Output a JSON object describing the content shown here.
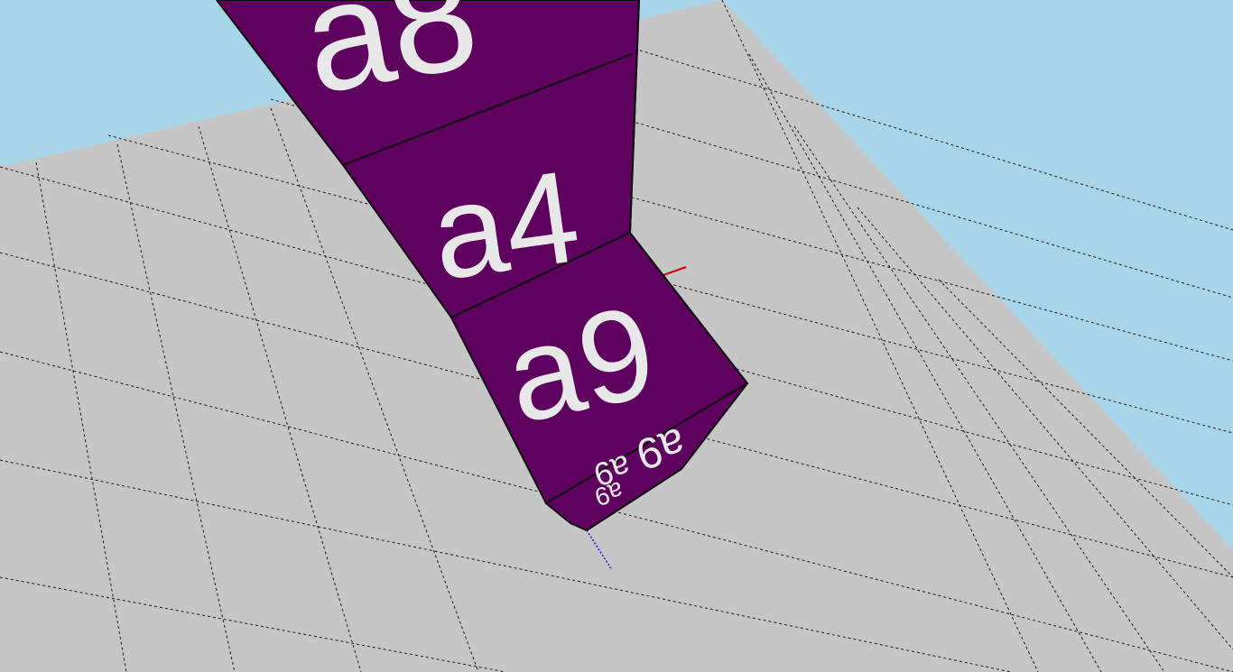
{
  "scene": {
    "sky_color": "#a8d6e8",
    "ground_color": "#c6c6c6",
    "grid_line_color": "#1a1a1a",
    "cube_color": "#5e005e",
    "cube_edge_color": "#101010",
    "label_color": "#e8e8e8"
  },
  "cubes": {
    "top_face_label": "a8",
    "front_upper_label": "a4",
    "front_lower_label": "a9",
    "bottom_label_1": "a9",
    "bottom_label_2": "a9",
    "bottom_label_3": "a9"
  },
  "axes": {
    "x_axis_color": "#cc0000",
    "z_axis_color": "#1a1acc"
  }
}
